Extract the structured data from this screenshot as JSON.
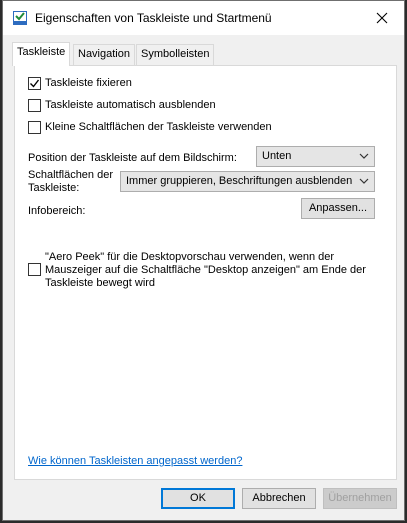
{
  "window": {
    "title": "Eigenschaften von Taskleiste und Startmenü"
  },
  "tabs": [
    {
      "label": "Taskleiste",
      "active": true
    },
    {
      "label": "Navigation",
      "active": false
    },
    {
      "label": "Symbolleisten",
      "active": false
    }
  ],
  "taskbar": {
    "lock": {
      "label": "Taskleiste fixieren",
      "checked": true
    },
    "autohide": {
      "label": "Taskleiste automatisch ausblenden",
      "checked": false
    },
    "small_buttons": {
      "label": "Kleine Schaltflächen der Taskleiste verwenden",
      "checked": false
    },
    "position_label": "Position der Taskleiste auf dem Bildschirm:",
    "position_value": "Unten",
    "buttons_label_line1": "Schaltflächen der",
    "buttons_label_line2": "Taskleiste:",
    "buttons_value": "Immer gruppieren, Beschriftungen ausblenden",
    "infobereich_label": "Infobereich:",
    "customize_button": "Anpassen...",
    "aero_peek": {
      "line1": "\"Aero Peek\" für die Desktopvorschau verwenden, wenn der",
      "line2": "Mauszeiger auf die Schaltfläche \"Desktop anzeigen\" am Ende der",
      "line3": "Taskleiste bewegt wird",
      "checked": false
    },
    "help_link": "Wie können Taskleisten angepasst werden?"
  },
  "buttons": {
    "ok": "OK",
    "cancel": "Abbrechen",
    "apply": "Übernehmen"
  },
  "colors": {
    "accent": "#0078d7",
    "link": "#0066cc",
    "dialog_bg": "#f0f0f0"
  }
}
